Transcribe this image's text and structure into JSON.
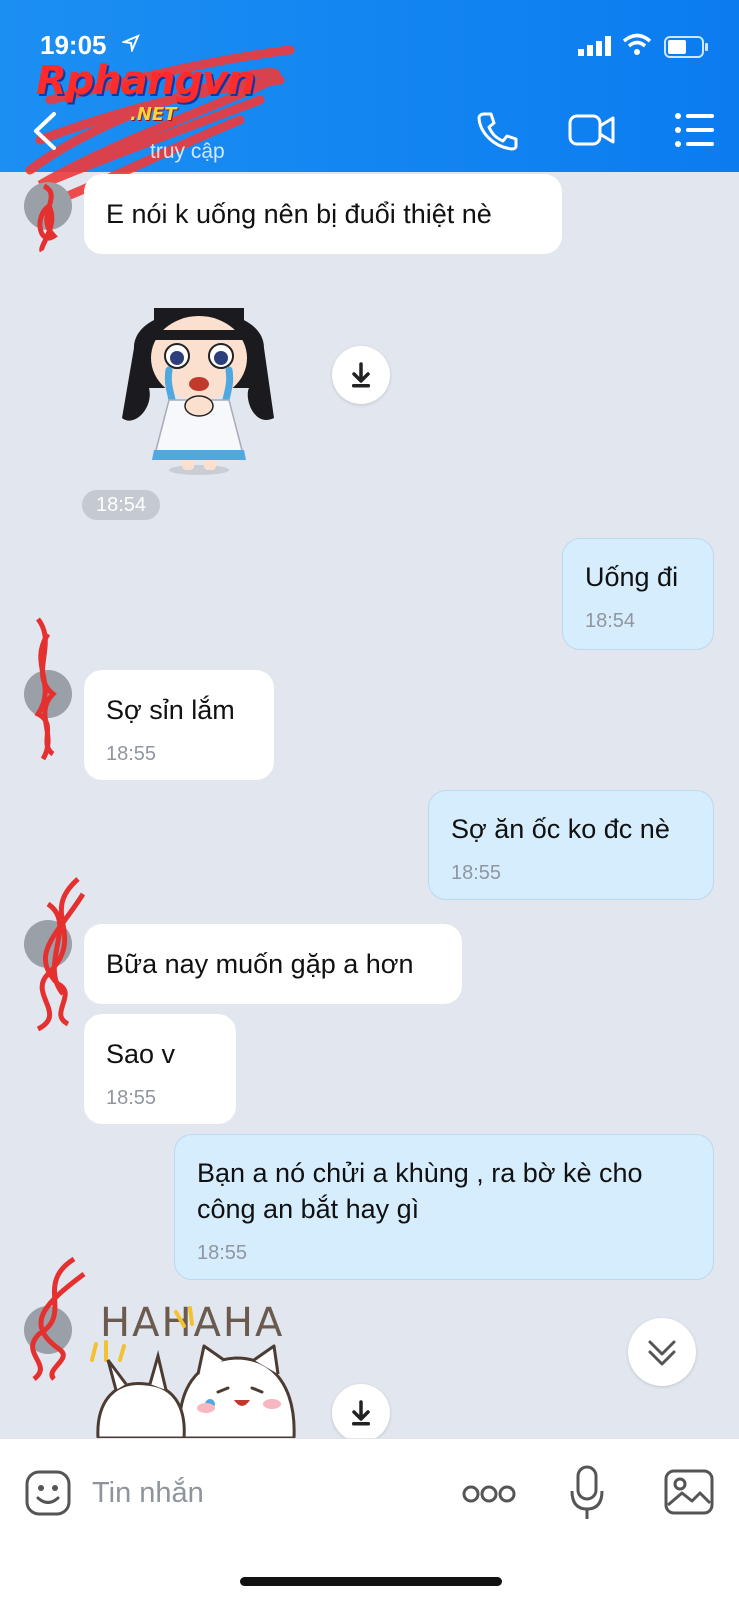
{
  "status_bar": {
    "time": "19:05"
  },
  "header": {
    "watermark": "Rphangvn",
    "watermark_suffix": ".NET",
    "subtitle": "truy cập"
  },
  "messages": [
    {
      "dir": "in",
      "text": "E nói k uống nên bị đuổi thiệt nè",
      "time": ""
    },
    {
      "dir": "out",
      "text": "Uống đi",
      "time": "18:54"
    },
    {
      "dir": "in",
      "text": "Sợ sỉn lắm",
      "time": "18:55"
    },
    {
      "dir": "out",
      "text": "Sợ ăn ốc ko đc nè",
      "time": "18:55"
    },
    {
      "dir": "in",
      "text": "Bữa nay muốn gặp a hơn",
      "time": ""
    },
    {
      "dir": "in",
      "text": "Sao v",
      "time": "18:55"
    },
    {
      "dir": "out",
      "text": "Bạn a nó chửi a khùng , ra bờ kè cho công an bắt hay gì",
      "time": "18:55"
    }
  ],
  "sticker_time": "18:54",
  "sticker2_text": "HAHAHA",
  "input": {
    "placeholder": "Tin nhắn"
  },
  "icons": {
    "back": "chevron-left-icon",
    "call": "phone-icon",
    "video": "video-camera-icon",
    "menu": "list-menu-icon",
    "download": "download-icon",
    "scroll": "double-chevron-down-icon",
    "emoji": "emoji-icon",
    "more": "more-dots-icon",
    "mic": "microphone-icon",
    "image": "image-icon"
  },
  "colors": {
    "header": "#0b7cf0",
    "chat_bg": "#e2e6ee",
    "incoming_bubble": "#ffffff",
    "outgoing_bubble": "#d5edfd"
  }
}
